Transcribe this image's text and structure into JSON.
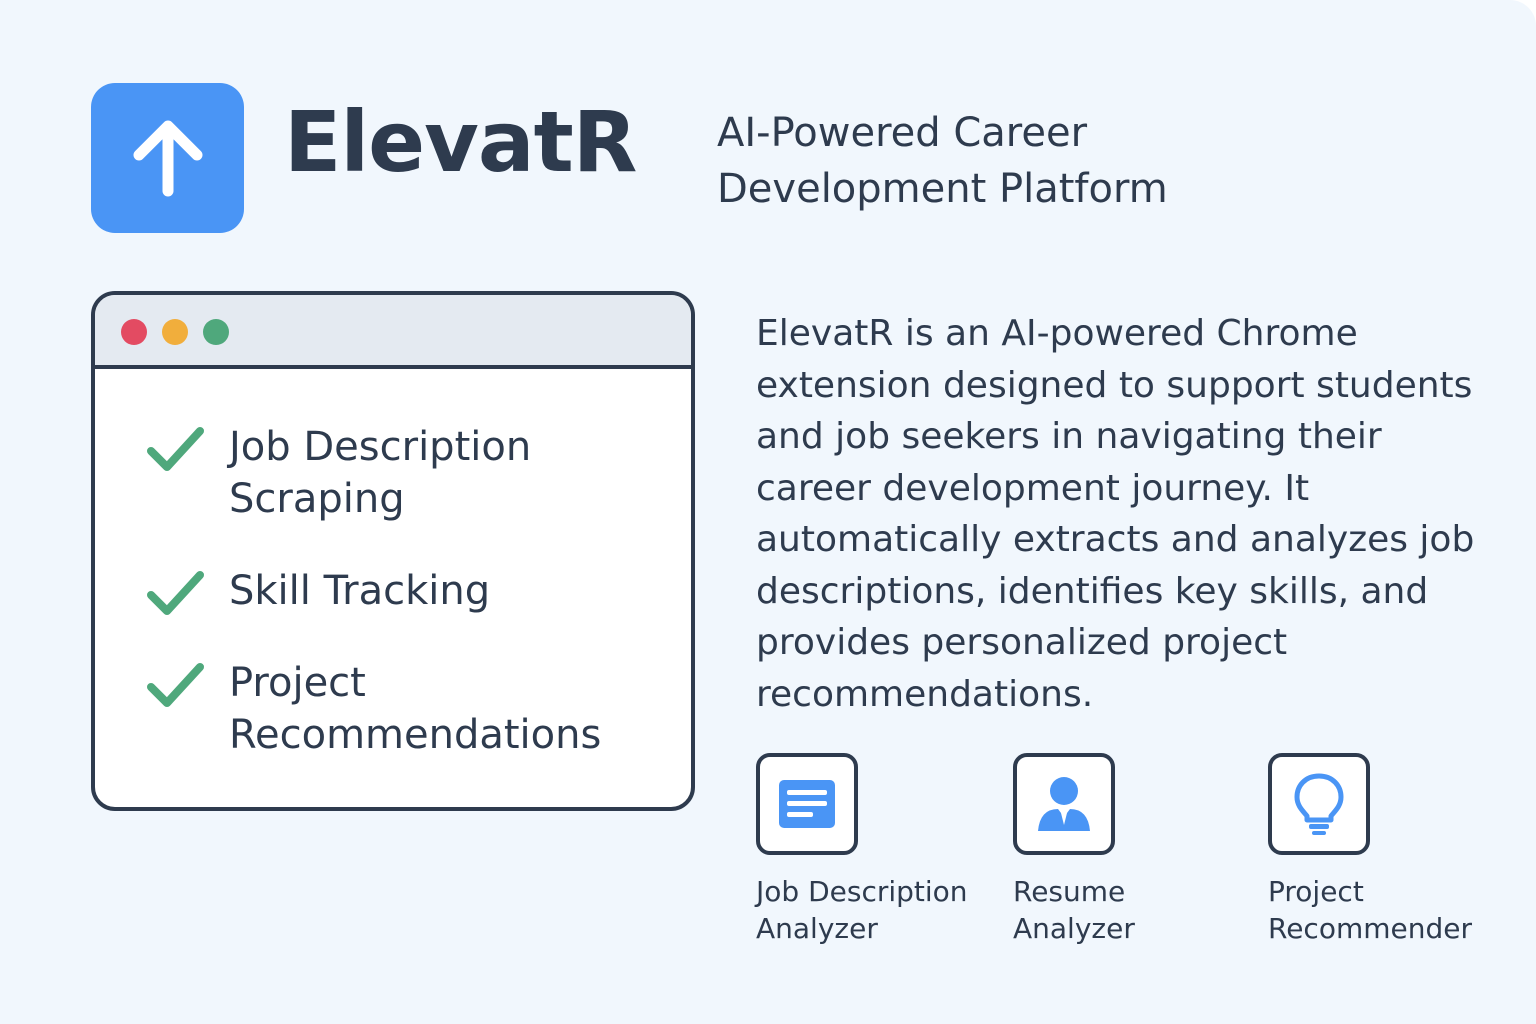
{
  "header": {
    "brand": "ElevatR",
    "tagline": "AI-Powered Career Development Platform",
    "logo_icon": "arrow-up-icon"
  },
  "features": [
    {
      "label": "Job Description Scraping",
      "icon": "check-icon"
    },
    {
      "label": "Skill Tracking",
      "icon": "check-icon"
    },
    {
      "label": "Project Recommendations",
      "icon": "check-icon"
    }
  ],
  "description": "ElevatR is an AI-powered Chrome extension designed to support students and job seekers in navigating their career development journey. It automatically extracts and analyzes job descriptions, identifies key skills, and provides personalized project recommendations.",
  "tools": [
    {
      "label": "Job Description Analyzer",
      "icon": "document-icon"
    },
    {
      "label": "Resume Analyzer",
      "icon": "user-icon"
    },
    {
      "label": "Project Recommender",
      "icon": "lightbulb-icon"
    }
  ],
  "colors": {
    "accent": "#4a95f5",
    "text": "#2e3b4e",
    "check": "#4fa87c",
    "background": "#f1f7fd"
  }
}
